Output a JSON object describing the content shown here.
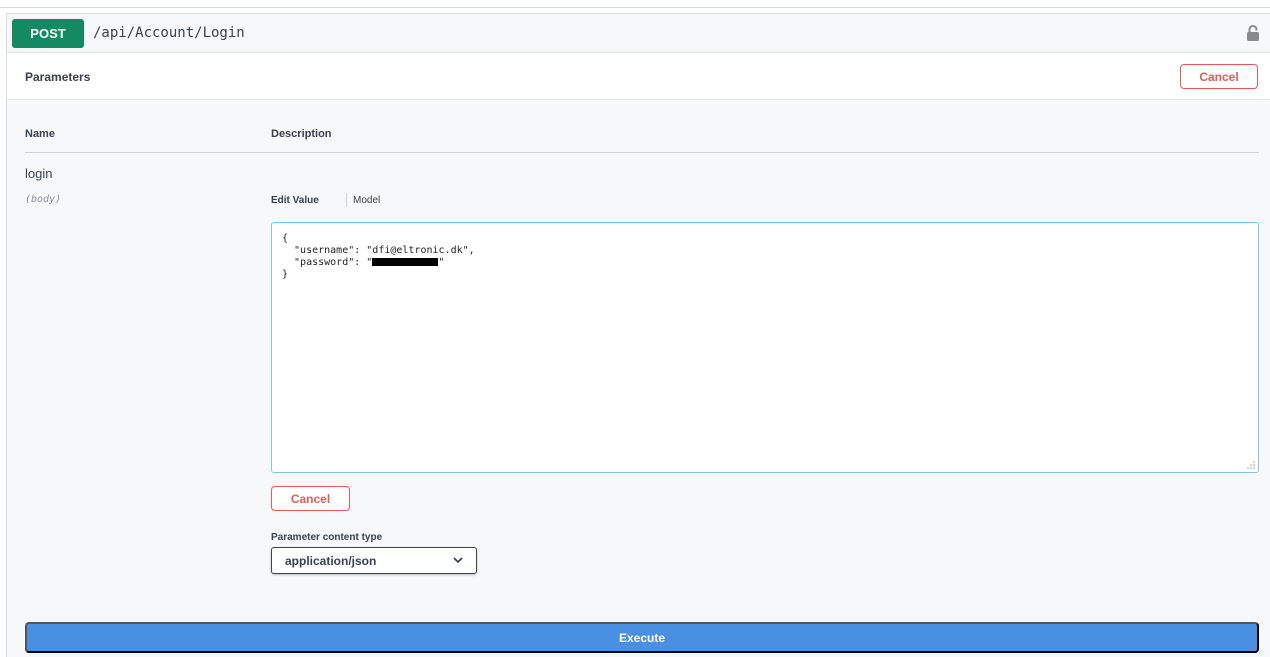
{
  "operation": {
    "method": "POST",
    "path": "/api/Account/Login",
    "method_color": "#148a62",
    "lock_icon": "lock-icon"
  },
  "parameters_section": {
    "title": "Parameters",
    "cancel_label": "Cancel"
  },
  "table": {
    "name_header": "Name",
    "description_header": "Description"
  },
  "parameter": {
    "name": "login",
    "in": "(body)",
    "tabs": {
      "edit_value": "Edit Value",
      "model": "Model"
    },
    "body_lines": {
      "open": "{",
      "username": "  \"username\": \"dfi@eltronic.dk\",",
      "password_prefix": "  \"password\": \"",
      "password_suffix": "\"",
      "close": "}"
    },
    "cancel_label": "Cancel",
    "content_type_label": "Parameter content type",
    "content_type_value": "application/json"
  },
  "execute_label": "Execute",
  "colors": {
    "cancel": "#e55b5b",
    "execute": "#4990e2"
  }
}
